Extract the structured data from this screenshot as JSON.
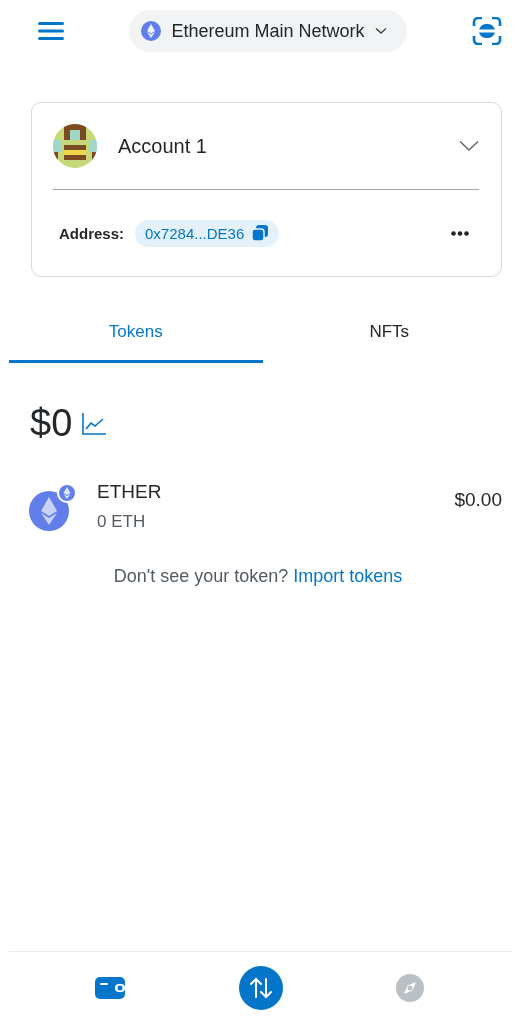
{
  "network": {
    "name": "Ethereum Main Network"
  },
  "account": {
    "name": "Account 1",
    "address_label": "Address:",
    "address": "0x7284...DE36"
  },
  "tabs": [
    {
      "label": "Tokens",
      "selected": true
    },
    {
      "label": "NFTs",
      "selected": false
    }
  ],
  "balance": "$0",
  "tokens": [
    {
      "name": "ETHER",
      "amount": "0 ETH",
      "value": "$0.00"
    }
  ],
  "import_prompt": {
    "text": "Don't see your token?",
    "link": "Import tokens"
  },
  "nav": [
    {
      "kind": "wallet",
      "selected": true
    },
    {
      "kind": "swap",
      "selected": false
    },
    {
      "kind": "browser",
      "selected": false
    }
  ]
}
